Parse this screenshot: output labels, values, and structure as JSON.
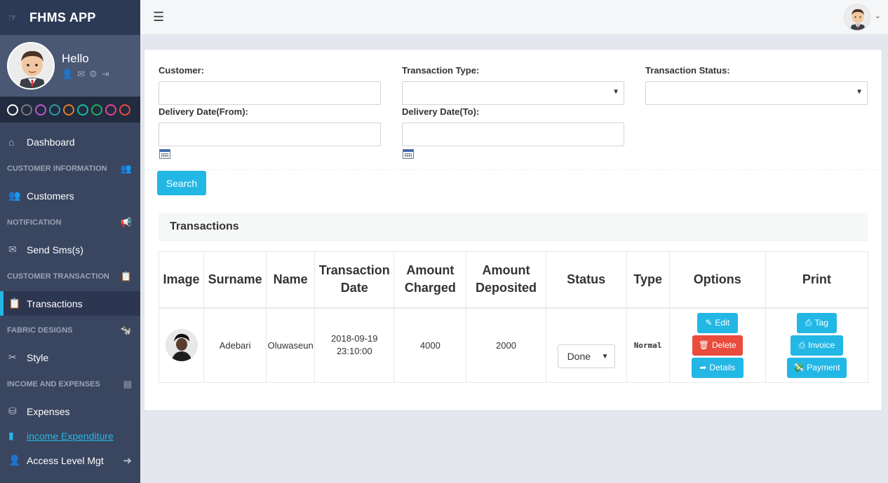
{
  "app": {
    "title": "FHMS APP"
  },
  "profile": {
    "greeting": "Hello"
  },
  "swatches": [
    "#ffffff",
    "#7a7a7a",
    "#c05ac8",
    "#2c9ca5",
    "#e67e22",
    "#1abc9c",
    "#27ae60",
    "#e84393",
    "#e74c3c"
  ],
  "sidebar": {
    "dashboard": "Dashboard",
    "sections": {
      "customer_information": "CUSTOMER INFORMATION",
      "notification": "NOTIFICATION",
      "customer_transaction": "CUSTOMER TRANSACTION",
      "fabric_designs": "FABRIC DESIGNS",
      "income_and_expenses": "INCOME AND EXPENSES"
    },
    "items": {
      "customers": "Customers",
      "send_sms": "Send Sms(s)",
      "transactions": "Transactions",
      "style": "Style",
      "expenses": "Expenses",
      "income_expenditure": "income Expenditure",
      "access_level": "Access Level Mgt"
    }
  },
  "filters": {
    "customer_label": "Customer:",
    "customer_value": "",
    "transaction_type_label": "Transaction Type:",
    "transaction_type_value": "",
    "transaction_status_label": "Transaction Status:",
    "transaction_status_value": "",
    "delivery_from_label": "Delivery Date(From):",
    "delivery_from_value": "",
    "delivery_to_label": "Delivery Date(To):",
    "delivery_to_value": "",
    "search_label": "Search"
  },
  "transactions": {
    "title": "Transactions",
    "headers": {
      "image": "Image",
      "surname": "Surname",
      "name": "Name",
      "transaction_date_1": "Transaction",
      "transaction_date_2": "Date",
      "amount_charged_1": "Amount",
      "amount_charged_2": "Charged",
      "amount_deposited_1": "Amount",
      "amount_deposited_2": "Deposited",
      "status": "Status",
      "type": "Type",
      "options": "Options",
      "print": "Print"
    },
    "rows": [
      {
        "surname": "Adebari",
        "name": "Oluwaseun",
        "date_1": "2018-09-19",
        "date_2": "23:10:00",
        "amount_charged": "4000",
        "amount_deposited": "2000",
        "status": "Done",
        "type": "Normal"
      }
    ],
    "options": {
      "edit": "Edit",
      "delete": "Delete",
      "details": "Details"
    },
    "print": {
      "tag": "Tag",
      "invoice": "Invoice",
      "payment": "Payment"
    }
  },
  "colors": {
    "sidebar": "#3a4660",
    "accent": "#23b7e5",
    "danger": "#e94b3c"
  }
}
